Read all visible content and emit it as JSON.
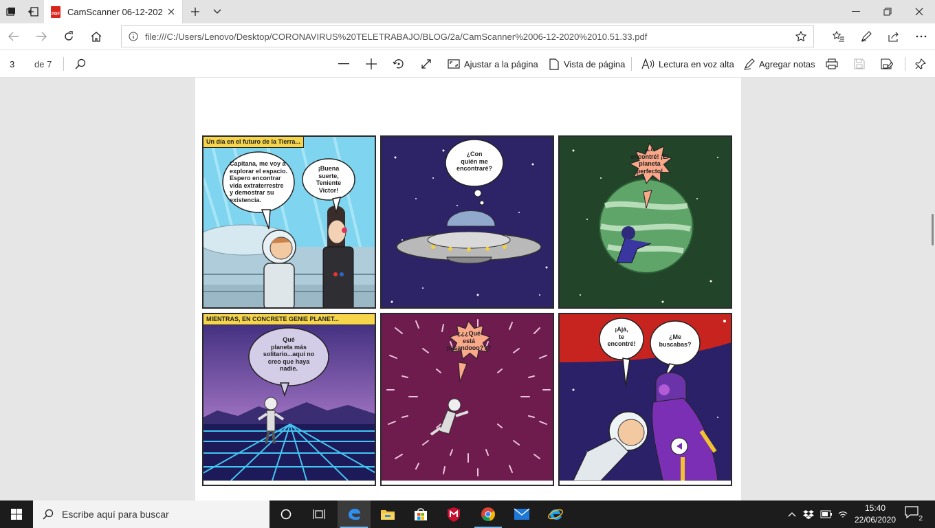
{
  "browser": {
    "tab": {
      "title": "CamScanner 06-12-202",
      "icon": "pdf-icon"
    },
    "address": {
      "url": "file:///C:/Users/Lenovo/Desktop/CORONAVIRUS%20TELETRABAJO/BLOG/2a/CamScanner%2006-12-2020%2010.51.33.pdf"
    }
  },
  "pdf_toolbar": {
    "page_current": "3",
    "page_total": "de 7",
    "fit_page": "Ajustar a la página",
    "page_view": "Vista de página",
    "read_aloud": "Lectura en voz alta",
    "add_notes": "Agregar notas"
  },
  "comic": {
    "panel1": {
      "caption": "Un día en el futuro de la Tierra...",
      "bubble_left": [
        "Capitana, me voy a",
        "explorar el espacio.",
        "Espero encontrar",
        "vida extraterrestre",
        "y demostrar su",
        "existencia."
      ],
      "bubble_right": [
        "¡Buena",
        "suerte,",
        "Teniente",
        "Victor!"
      ]
    },
    "panel2": {
      "bubble": [
        "¿Con",
        "quién me",
        "encontraré?"
      ]
    },
    "panel3": {
      "bubble": [
        "¡Lo",
        "encontré! ¡El",
        "planeta",
        "perfecto!"
      ]
    },
    "panel4": {
      "caption": "MIENTRAS, EN CONCRETE GENIE PLANET...",
      "bubble": [
        "Qué",
        "planeta más",
        "solitario...aquí no",
        "creo que haya",
        "nadie."
      ]
    },
    "panel5": {
      "bubble": [
        "¿¿¿Qué",
        "está",
        "pasandooo???"
      ]
    },
    "panel6": {
      "bubble_left": [
        "¡Ajá,",
        "te",
        "encontré!"
      ],
      "bubble_right": [
        "¿Me",
        "buscabas?"
      ]
    }
  },
  "taskbar": {
    "search_placeholder": "Escribe aquí para buscar",
    "time": "15:40",
    "date": "22/06/2020",
    "notification_count": "2"
  }
}
